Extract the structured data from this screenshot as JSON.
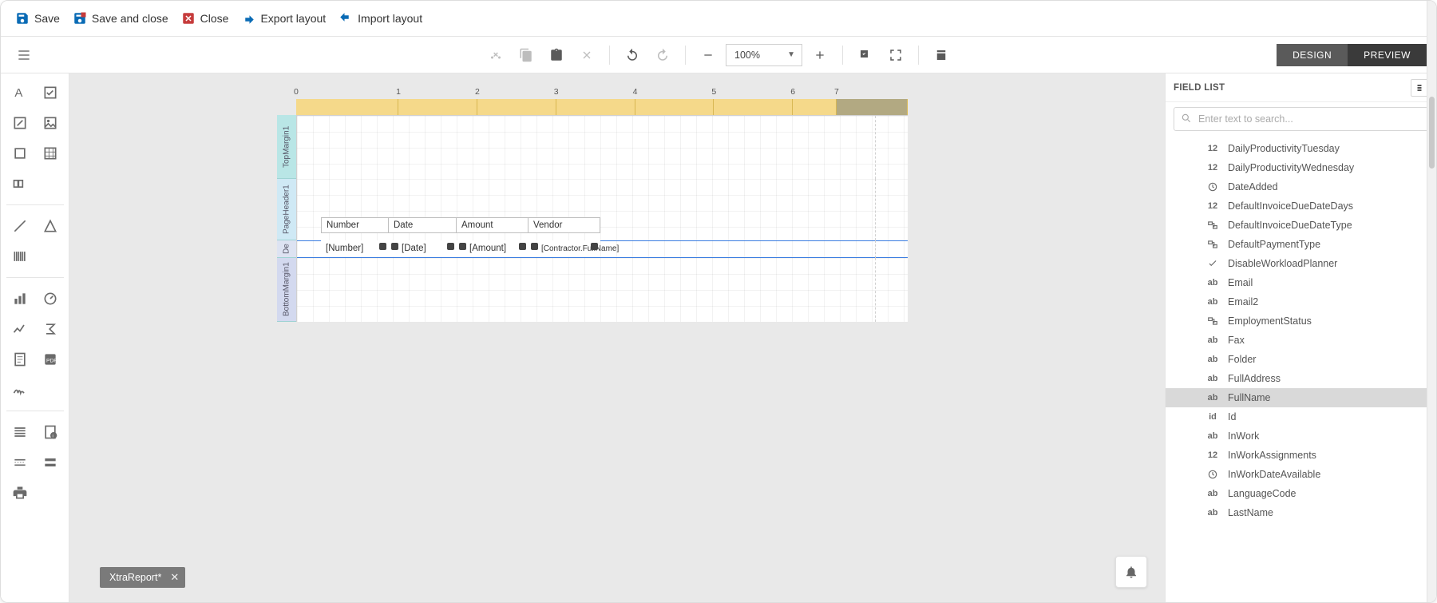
{
  "commands": {
    "save": "Save",
    "save_close": "Save and close",
    "close": "Close",
    "export": "Export layout",
    "import": "Import layout"
  },
  "toolbar": {
    "zoom": "100%"
  },
  "mode_tabs": {
    "design": "DESIGN",
    "preview": "PREVIEW"
  },
  "ruler": {
    "ticks": [
      "0",
      "1",
      "2",
      "3",
      "4",
      "5",
      "6",
      "7"
    ]
  },
  "bands": {
    "top": "TopMargin1",
    "header": "PageHeader1",
    "detail": "De",
    "bottom": "BottomMargin1"
  },
  "header_cells": {
    "number": "Number",
    "date": "Date",
    "amount": "Amount",
    "vendor": "Vendor"
  },
  "detail_cells": {
    "number": "[Number]",
    "date": "[Date]",
    "amount": "[Amount]",
    "vendor": "[Contractor.FullName]"
  },
  "doc_tab": "XtraReport*",
  "right_panel": {
    "title": "FIELD LIST",
    "search_placeholder": "Enter text to search...",
    "fields": [
      {
        "type": "num",
        "label": "DailyProductivityTuesday"
      },
      {
        "type": "num",
        "label": "DailyProductivityWednesday"
      },
      {
        "type": "clock",
        "label": "DateAdded"
      },
      {
        "type": "num",
        "label": "DefaultInvoiceDueDateDays"
      },
      {
        "type": "enum",
        "label": "DefaultInvoiceDueDateType"
      },
      {
        "type": "enum",
        "label": "DefaultPaymentType"
      },
      {
        "type": "check",
        "label": "DisableWorkloadPlanner"
      },
      {
        "type": "str",
        "label": "Email"
      },
      {
        "type": "str",
        "label": "Email2"
      },
      {
        "type": "enum",
        "label": "EmploymentStatus"
      },
      {
        "type": "str",
        "label": "Fax"
      },
      {
        "type": "str",
        "label": "Folder"
      },
      {
        "type": "str",
        "label": "FullAddress"
      },
      {
        "type": "str",
        "label": "FullName",
        "selected": true
      },
      {
        "type": "id",
        "label": "Id"
      },
      {
        "type": "str",
        "label": "InWork"
      },
      {
        "type": "num",
        "label": "InWorkAssignments"
      },
      {
        "type": "clock",
        "label": "InWorkDateAvailable"
      },
      {
        "type": "str",
        "label": "LanguageCode"
      },
      {
        "type": "str",
        "label": "LastName"
      }
    ]
  }
}
